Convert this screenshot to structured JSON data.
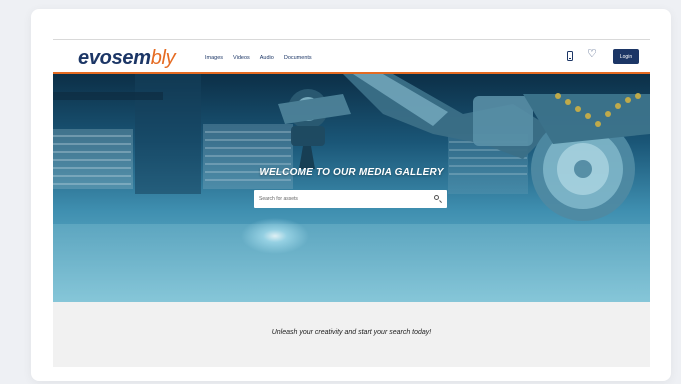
{
  "brand": {
    "part1": "evosem",
    "part2": "bly"
  },
  "nav": [
    {
      "label": "Images"
    },
    {
      "label": "Videos"
    },
    {
      "label": "Audio"
    },
    {
      "label": "Documents"
    }
  ],
  "header": {
    "login_label": "Login",
    "phone_icon": "phone-icon",
    "heart_icon": "heart-icon"
  },
  "hero": {
    "title": "WELCOME TO OUR MEDIA GALLERY",
    "search_placeholder": "Search for assets",
    "search_icon": "search-icon"
  },
  "footer": {
    "tagline": "Unleash your creativity and start your search today!"
  },
  "colors": {
    "brand_navy": "#1c3666",
    "brand_orange": "#e56b22"
  }
}
